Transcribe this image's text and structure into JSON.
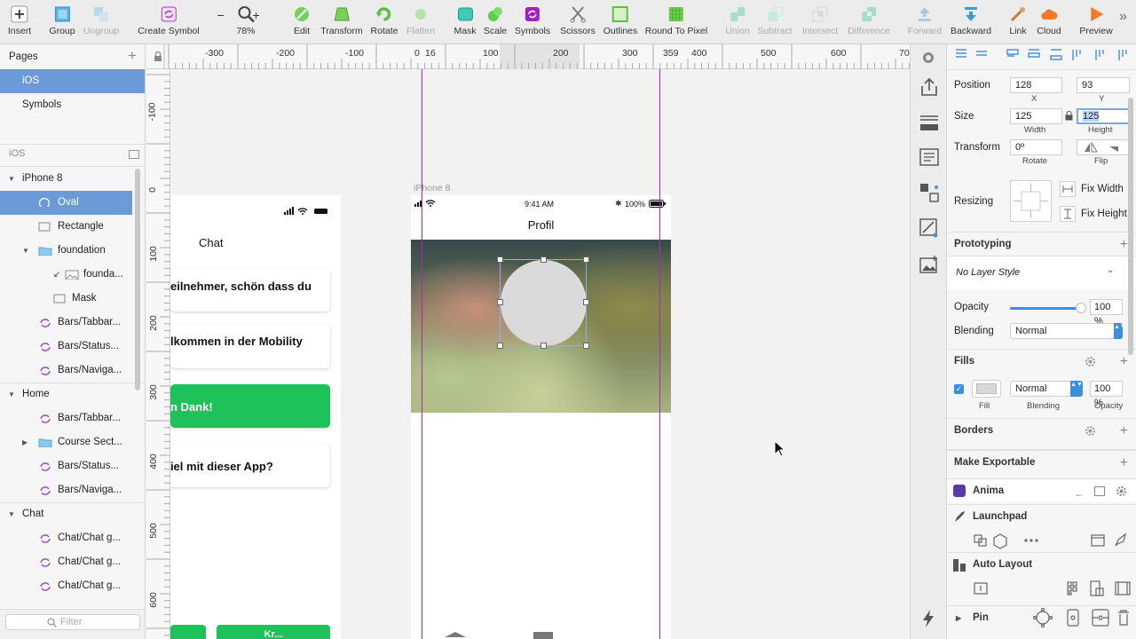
{
  "toolbar": {
    "items": [
      "Insert",
      "Group",
      "Ungroup",
      "Create Symbol",
      "78%",
      "Edit",
      "Transform",
      "Rotate",
      "Flatten",
      "Mask",
      "Scale",
      "Symbols",
      "Scissors",
      "Outlines",
      "Round To Pixel",
      "Union",
      "Subtract",
      "Intersect",
      "Difference",
      "Forward",
      "Backward",
      "Link",
      "Cloud",
      "Preview"
    ],
    "zoom_minus": "−",
    "zoom_plus": "+"
  },
  "pages": {
    "title": "Pages",
    "items": [
      "iOS",
      "Symbols"
    ],
    "layers_title": "iOS",
    "filter_placeholder": "Filter"
  },
  "layers": {
    "items": [
      "iPhone 8",
      "Oval",
      "Rectangle",
      "foundation",
      "founda...",
      "Mask",
      "Bars/Tabbar...",
      "Bars/Status...",
      "Bars/Naviga...",
      "Home",
      "Bars/Tabbar...",
      "Course Sect...",
      "Bars/Status...",
      "Bars/Naviga...",
      "Chat",
      "Chat/Chat g...",
      "Chat/Chat g...",
      "Chat/Chat g..."
    ]
  },
  "ruler": {
    "top": [
      "-300",
      "-200",
      "-100",
      "0",
      "16",
      "100",
      "200",
      "300",
      "359",
      "400",
      "500",
      "600",
      "70"
    ],
    "left": [
      "-100",
      "0",
      "100",
      "200",
      "300",
      "400",
      "500",
      "600"
    ]
  },
  "canvas": {
    "artboard_label": "iPhone 8",
    "status_time": "9:41 AM",
    "battery": "100%",
    "profile_title": "Profil",
    "chat_title": "Chat",
    "chat_cards": [
      "eilnehmer, schön dass du",
      "lkommen in der Mobility",
      "n Dank!",
      "Ziel mit dieser App?"
    ],
    "partial_button": "Kr..."
  },
  "inspector": {
    "position_label": "Position",
    "pos_x": "128",
    "pos_y": "93",
    "x_label": "X",
    "y_label": "Y",
    "size_label": "Size",
    "width": "125",
    "height": "125",
    "width_label": "Width",
    "height_label": "Height",
    "transform_label": "Transform",
    "rotate_value": "0º",
    "rotate_label": "Rotate",
    "flip_label": "Flip",
    "resizing_label": "Resizing",
    "fix_width": "Fix Width",
    "fix_height": "Fix Height",
    "prototyping": "Prototyping",
    "layer_style": "No Layer Style",
    "opacity_label": "Opacity",
    "opacity_value": "100 %",
    "opacity_fraction": 1.0,
    "blending_label": "Blending",
    "blending_value": "Normal",
    "fills": "Fills",
    "fill_blending": "Normal",
    "fill_opacity": "100 %",
    "fill_label": "Fill",
    "fill_blending_label": "Blending",
    "fill_opacity_label": "Opacity",
    "borders": "Borders",
    "make_exportable": "Make Exportable",
    "anima": "Anima",
    "launchpad": "Launchpad",
    "auto_layout": "Auto Layout",
    "pin": "Pin"
  },
  "colors": {
    "selection": "#6c9ad8",
    "green_button": "#1ec15a",
    "guide": "#b026b0",
    "symbol": "#a040c0"
  }
}
